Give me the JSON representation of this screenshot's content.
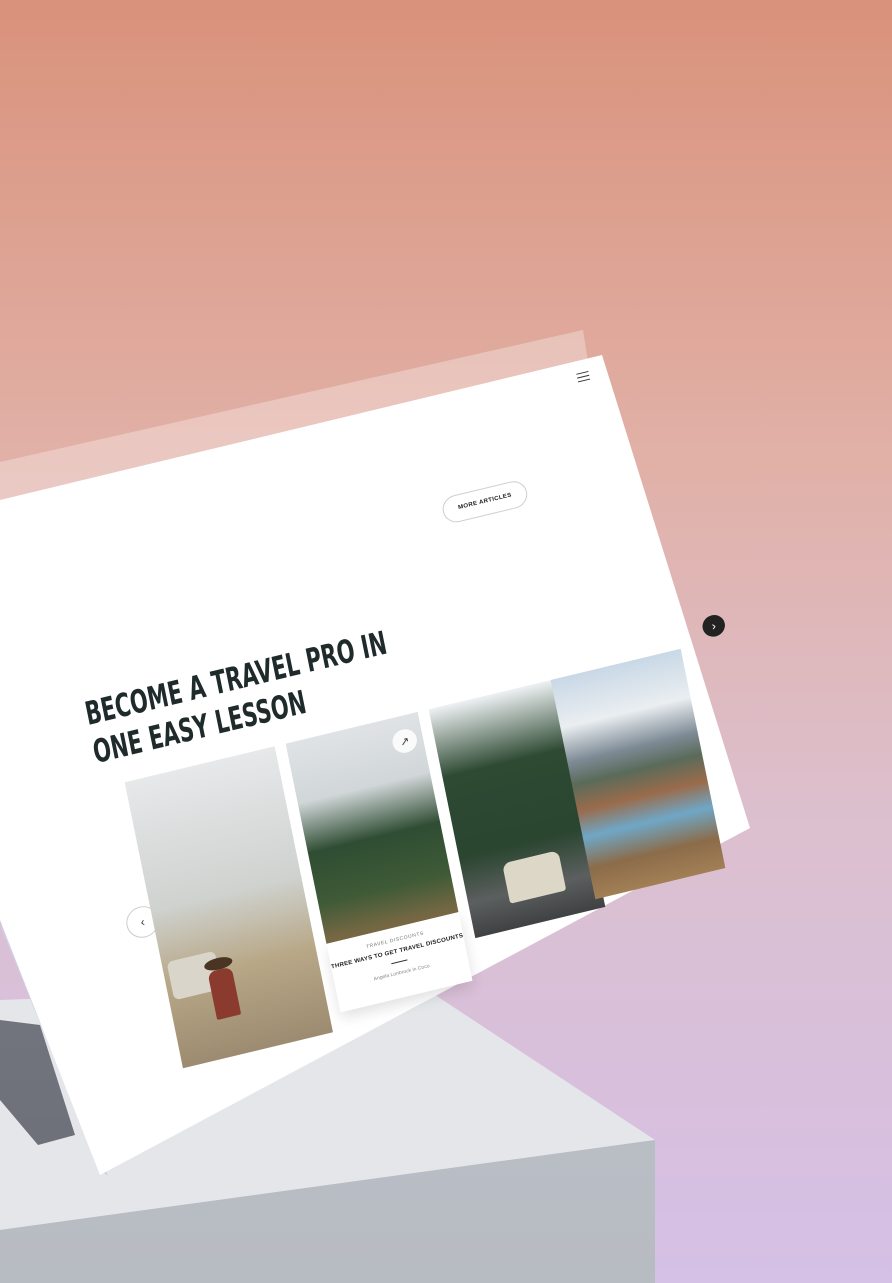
{
  "menu": {
    "icon": "hamburger-menu-icon"
  },
  "header": {
    "more_button_label": "MORE ARTICLES"
  },
  "hero": {
    "line1": "BECOME A TRAVEL PRO IN",
    "line2": "ONE EASY LESSON"
  },
  "carousel": {
    "prev_icon": "chevron-left-icon",
    "next_icon": "chevron-right-icon",
    "prev_glyph": "‹",
    "next_glyph": "›",
    "featured": {
      "category": "TRAVEL DISCOUNTS",
      "title": "THREE WAYS TO GET TRAVEL DISCOUNTS",
      "author": "Angela Lonbrock in Coco",
      "share_icon": "share-icon",
      "share_glyph": "↗"
    },
    "tiles": [
      "campsite-photo",
      "forest-road-photo",
      "camper-van-photo",
      "mountain-lake-photo"
    ]
  },
  "colors": {
    "accent": "#222222",
    "headline": "#1f2a2b",
    "background_top": "#d9927b",
    "background_bottom": "#d5c0e6"
  }
}
